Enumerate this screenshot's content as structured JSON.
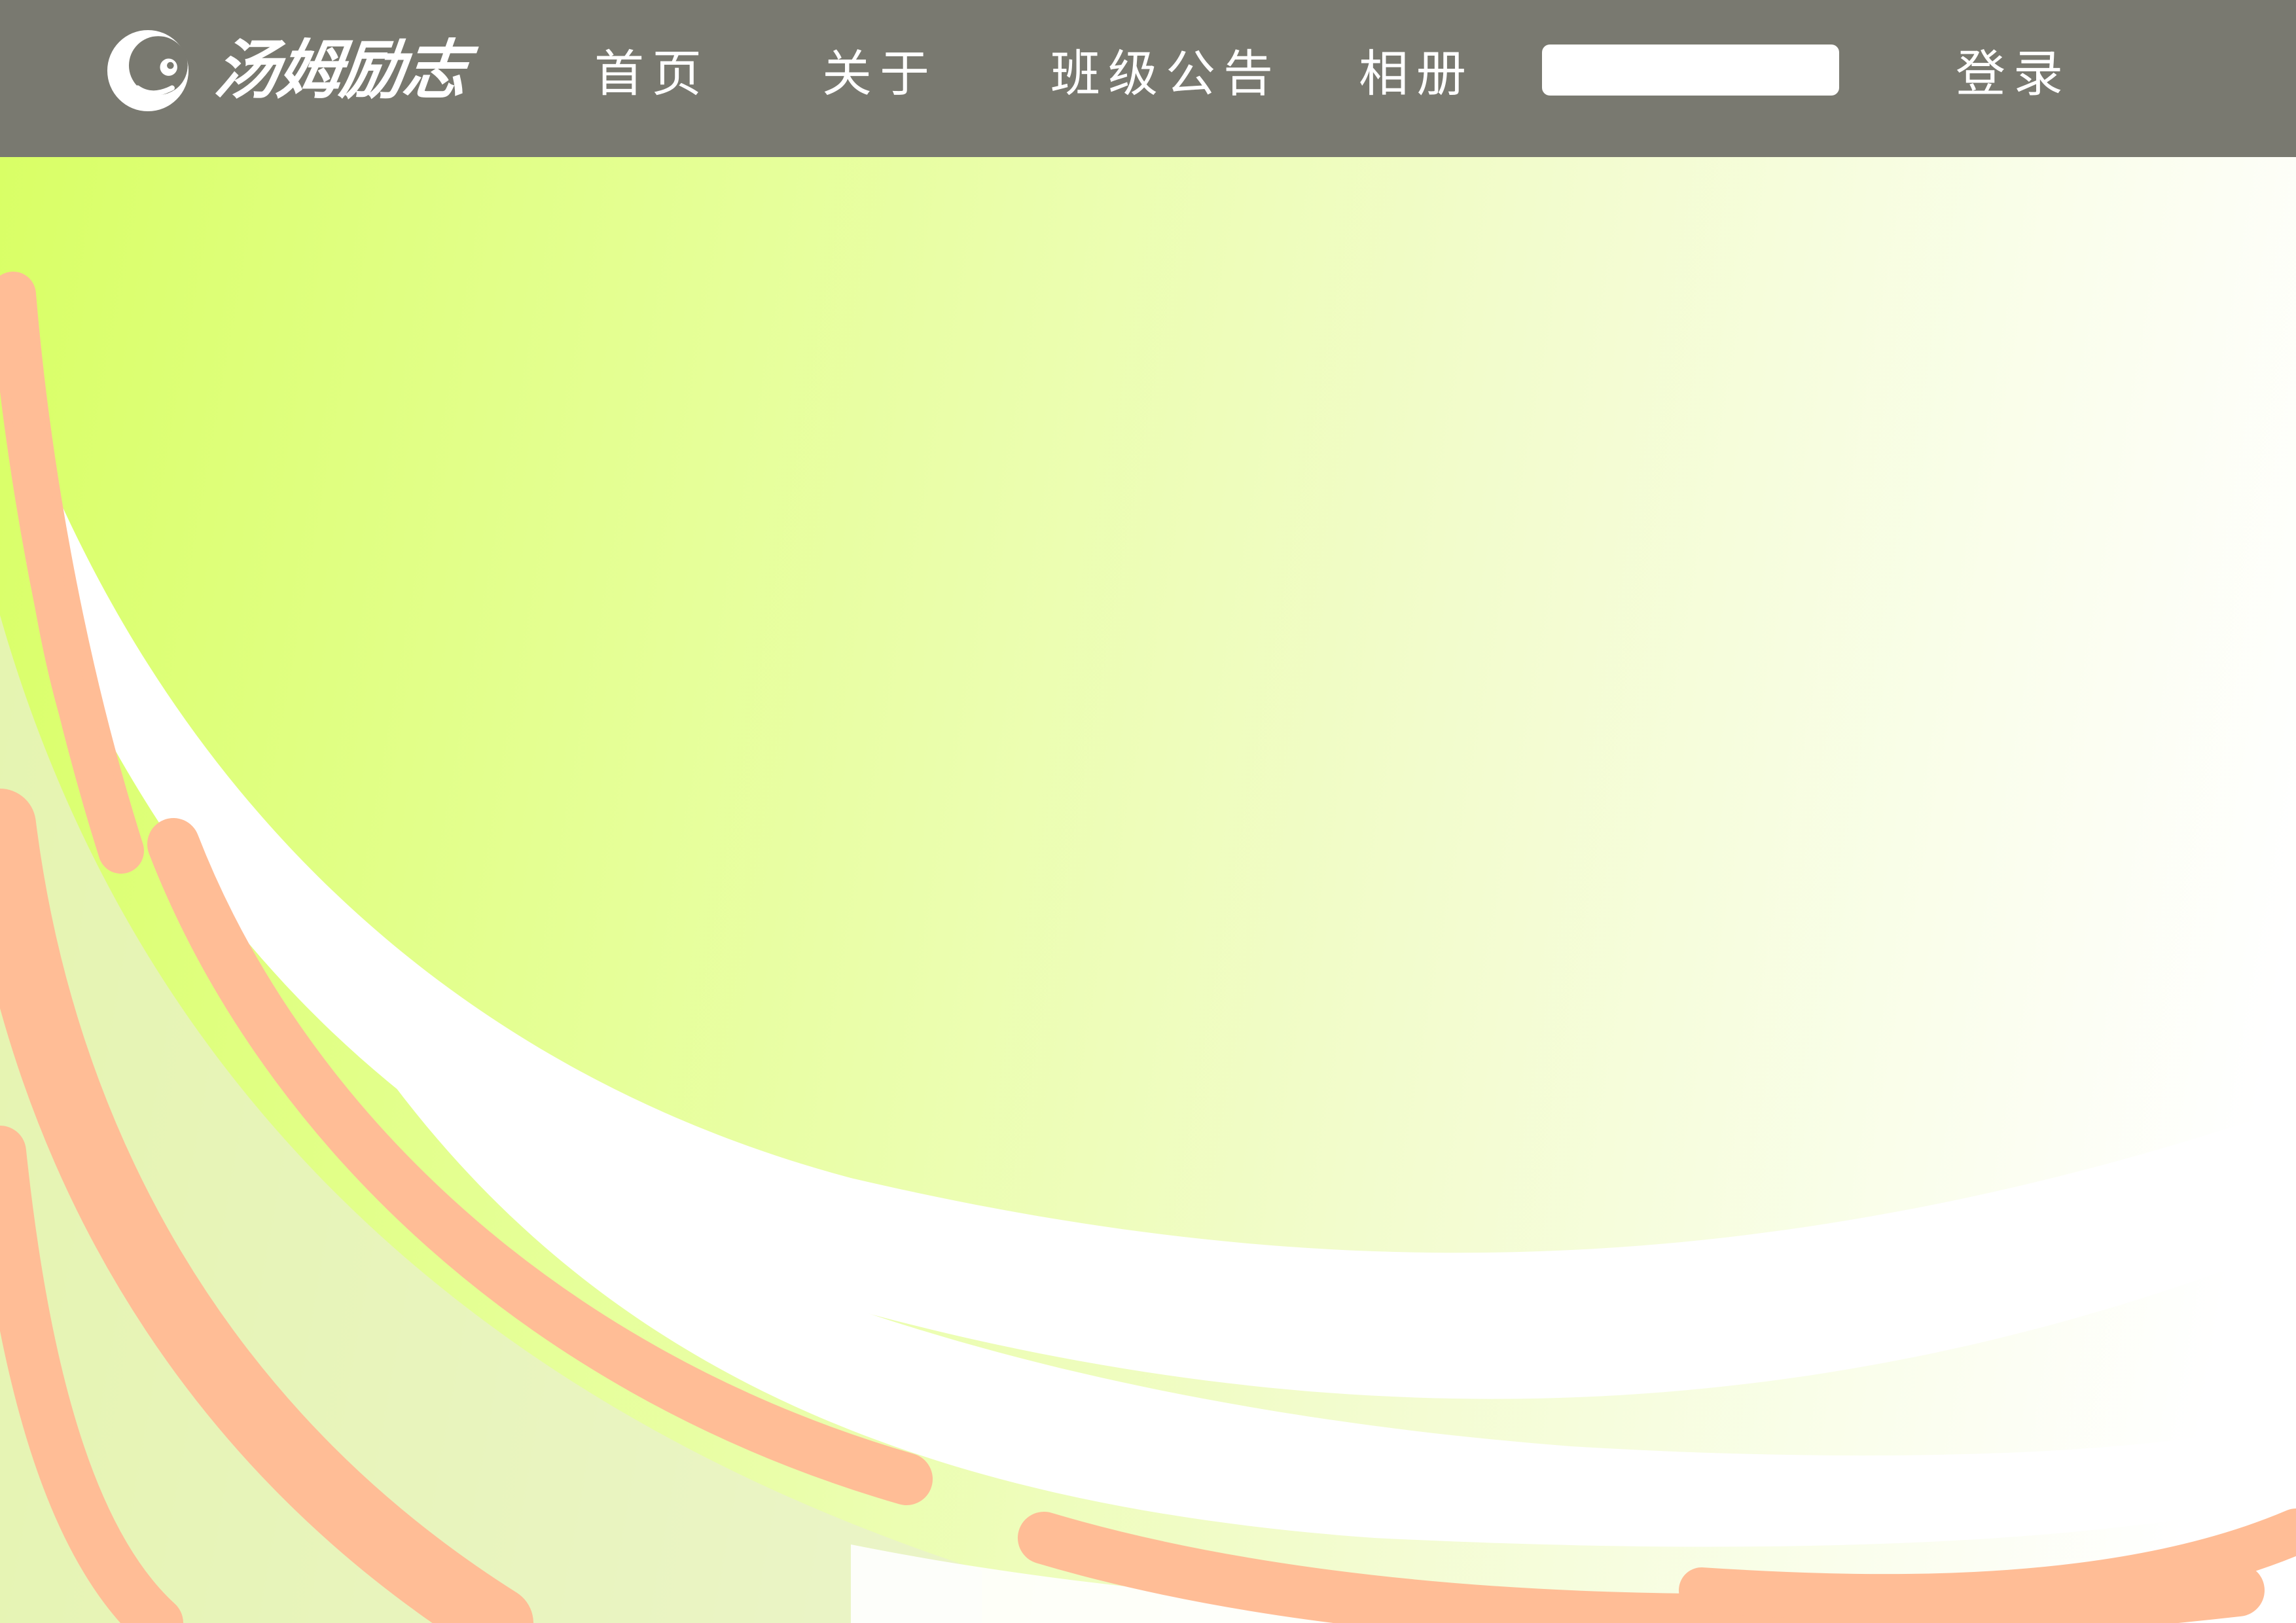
{
  "brand": {
    "name": "汤姆励志"
  },
  "nav": {
    "home": "首页",
    "about": "关于",
    "notice": "班级公告",
    "album": "相册",
    "login": "登录"
  },
  "search": {
    "value": "",
    "placeholder": ""
  },
  "colors": {
    "navbar": "#797970",
    "accent_stroke": "#ffbd96",
    "hero_start": "#d9ff66",
    "hero_end": "#ffffff"
  },
  "icons": {
    "logo": "moon-face-logo-icon"
  }
}
